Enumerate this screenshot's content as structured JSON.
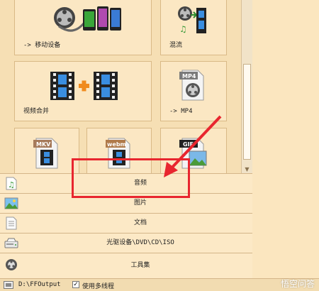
{
  "tiles": {
    "mobile_device": "-> 移动设备",
    "mux": "混流",
    "video_join": "视频合并",
    "to_mp4": "-> MP4",
    "mp4_badge": "MP4",
    "mkv_badge": "MKV",
    "webm_badge": "webm",
    "gif_badge": "GIF"
  },
  "categories": [
    {
      "label": "音频",
      "icon": "music-file-icon"
    },
    {
      "label": "图片",
      "icon": "landscape-picture-icon"
    },
    {
      "label": "文档",
      "icon": "document-icon"
    },
    {
      "label": "光驱设备\\DVD\\CD\\ISO",
      "icon": "optical-drive-icon"
    },
    {
      "label": "工具集",
      "icon": "gear-toolbox-icon"
    }
  ],
  "status": {
    "output_path": "D:\\FFOutput",
    "multithread_label": "使用多线程",
    "multithread_checked": true
  },
  "watermark": "悟空问答",
  "colors": {
    "background": "#fbe6bf",
    "tile": "#fbe7c3",
    "highlight": "#e8262f"
  }
}
